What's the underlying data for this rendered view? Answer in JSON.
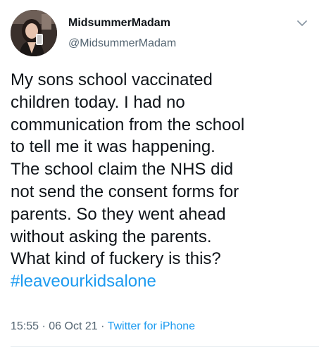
{
  "author": {
    "display_name": "MidsummerMadam",
    "handle": "@MidsummerMadam",
    "avatar_icon": "profile-photo"
  },
  "menu": {
    "icon": "chevron-down-icon"
  },
  "tweet": {
    "lines": [
      "My sons school vaccinated",
      "children today. I had no",
      "communication from the school",
      "to tell me it was happening.",
      "The school claim the NHS did",
      "not send the consent forms for",
      "parents. So they went ahead",
      "without asking the parents.",
      "What kind of fuckery is this?"
    ],
    "hashtag": "#leaveourkidsalone"
  },
  "meta": {
    "time": "15:55",
    "separator_1": " · ",
    "date": "06 Oct 21",
    "separator_2": " · ",
    "source": "Twitter for iPhone"
  },
  "colors": {
    "text": "#0f1419",
    "secondary": "#536471",
    "link": "#1d9bf0"
  }
}
